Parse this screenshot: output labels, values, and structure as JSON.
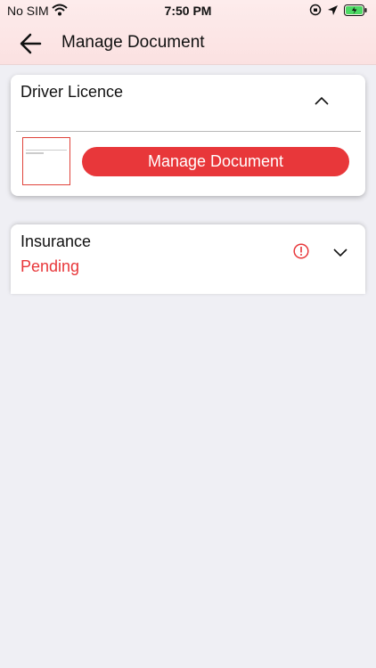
{
  "status_bar": {
    "carrier": "No SIM",
    "time": "7:50 PM",
    "battery_color": "#4cd964"
  },
  "nav": {
    "title": "Manage Document"
  },
  "documents": [
    {
      "title": "Driver Licence",
      "expanded": true,
      "action_label": "Manage Document"
    },
    {
      "title": "Insurance",
      "status": "Pending",
      "expanded": false
    }
  ],
  "colors": {
    "accent": "#e8373a",
    "header_bg": "#fbe1e1",
    "page_bg": "#efeff4"
  }
}
